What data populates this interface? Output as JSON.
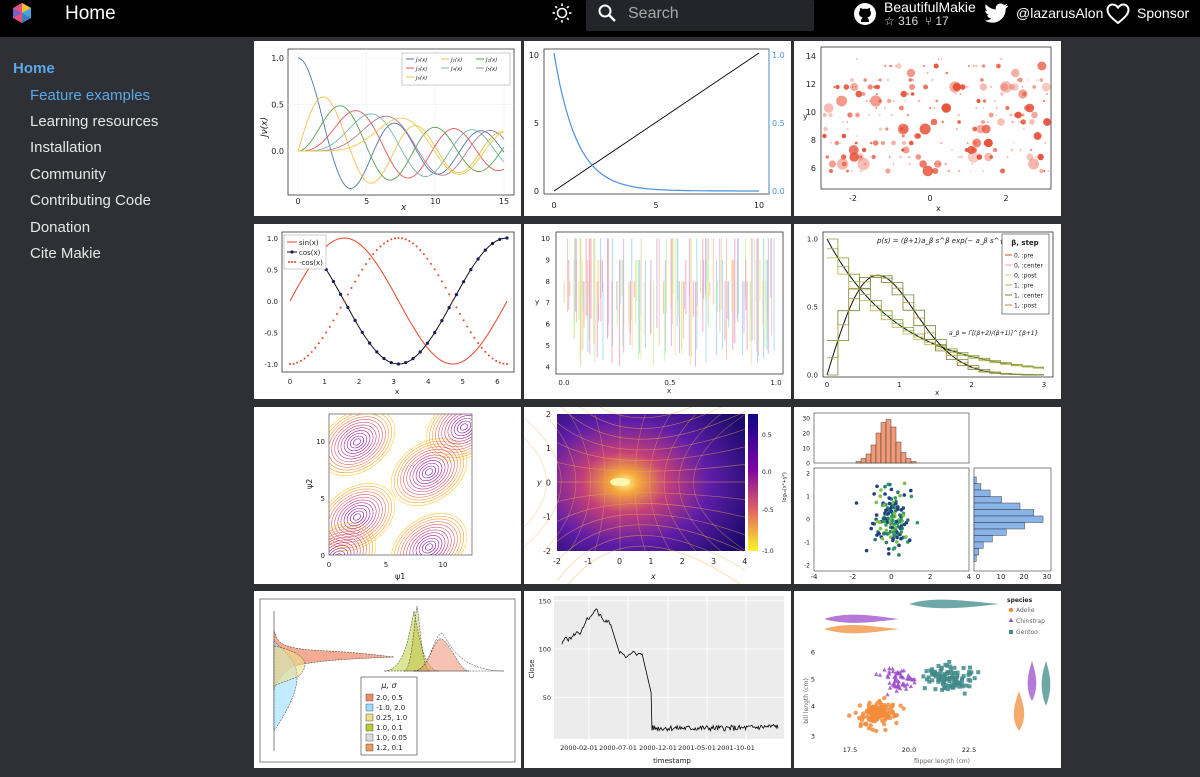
{
  "header": {
    "title": "Home",
    "search_placeholder": "Search",
    "github": {
      "name": "BeautifulMakie",
      "stars": "316",
      "forks": "17"
    },
    "twitter": "@lazarusAlon",
    "sponsor": "Sponsor"
  },
  "sidebar": {
    "home": "Home",
    "items": [
      {
        "label": "Feature examples",
        "active": true
      },
      {
        "label": "Learning resources"
      },
      {
        "label": "Installation"
      },
      {
        "label": "Community"
      },
      {
        "label": "Contributing Code"
      },
      {
        "label": "Donation"
      },
      {
        "label": "Cite Makie"
      }
    ]
  },
  "icons": {
    "logo": "makie-logo-icon",
    "theme": "sun-icon",
    "search": "search-icon",
    "github": "github-icon",
    "twitter": "twitter-icon",
    "sponsor": "heart-icon"
  },
  "colors": {
    "accent": "#5aa9e6",
    "topbar": "#000000",
    "background": "#2e3036"
  },
  "gallery": {
    "bessel": {
      "xticks": [
        "0",
        "5",
        "10",
        "15"
      ],
      "yticks": [
        "0.0",
        "0.5",
        "1.0"
      ],
      "xlabel": "x",
      "ylabel": "Jν(x)",
      "legend": [
        "J₀(x)",
        "J₁(x)",
        "J₂(x)",
        "J₃(x)",
        "J₄(x)",
        "J₅(x)",
        "J₆(x)"
      ]
    },
    "twin_axes": {
      "xticks": [
        "0",
        "5",
        "10"
      ],
      "yticks_left": [
        "0",
        "5",
        "10"
      ],
      "yticks_right": [
        "0.0",
        "0.5",
        "1.0"
      ]
    },
    "bubbles": {
      "xticks": [
        "-2",
        "0",
        "2"
      ],
      "yticks": [
        "6",
        "8",
        "10",
        "12",
        "14"
      ],
      "xlabel": "x",
      "ylabel": "y"
    },
    "trig": {
      "xticks": [
        "0",
        "1",
        "2",
        "3",
        "4",
        "5",
        "6"
      ],
      "yticks": [
        "-1.0",
        "-0.5",
        "0.0",
        "0.5",
        "1.0"
      ],
      "xlabel": "x",
      "legend": [
        "sin(x)",
        "cos(x)",
        "-cos(x)"
      ]
    },
    "rugs": {
      "xticks": [
        "0.0",
        "0.5",
        "1.0"
      ],
      "yticks": [
        "4",
        "5",
        "6",
        "7",
        "8",
        "9",
        "10"
      ],
      "xlabel": "x",
      "ylabel": "y"
    },
    "stairs": {
      "xticks": [
        "0",
        "1",
        "2",
        "3"
      ],
      "yticks": [
        "0.0",
        "0.5",
        "1.0"
      ],
      "xlabel": "x",
      "legend_title": "β, step",
      "legend": [
        "0, :pre",
        "0, :center",
        "0, :post",
        "1, :pre",
        "1, :center",
        "1, :post"
      ],
      "formula_top": "p(s) = (β+1)a_β s^β exp(− a_β s^{β+1})",
      "formula_bottom": "a_β = Γ[(β+2)/(β+1)]^{β+1}"
    },
    "contour": {
      "xticks": [
        "0",
        "5",
        "10"
      ],
      "yticks": [
        "0",
        "5",
        "10"
      ],
      "xlabel": "ψ1",
      "ylabel": "ψ2"
    },
    "streamplot": {
      "xticks": [
        "-2",
        "-1",
        "0",
        "1",
        "2",
        "3",
        "4"
      ],
      "yticks": [
        "-2",
        "-1",
        "0",
        "1",
        "2"
      ],
      "xlabel": "x",
      "ylabel": "y",
      "colorbar_ticks": [
        "0.5",
        "0.0",
        "-0.5",
        "-1.0"
      ],
      "colorbar_label": "log₁₀(x²+y²)"
    },
    "marginal": {
      "top_yticks": [
        "0",
        "10",
        "20",
        "30"
      ],
      "xticks": [
        "-4",
        "-2",
        "0",
        "2",
        "4"
      ],
      "yticks": [
        "-2",
        "-1",
        "0",
        "1",
        "2"
      ],
      "right_xticks": [
        "0",
        "10",
        "20",
        "30"
      ]
    },
    "densities": {
      "legend_title": "μ, σ",
      "legend": [
        "2.0, 0.5",
        "-1.0, 2.0",
        "0.25, 1.0",
        "1.0, 0.1",
        "1.0, 0.05",
        "1.2, 0.1"
      ]
    },
    "timeseries": {
      "xticks": [
        "2000-02-01",
        "2000-07-01",
        "2000-12-01",
        "2001-05-01",
        "2001-10-01"
      ],
      "yticks": [
        "50",
        "100",
        "150"
      ],
      "xlabel": "timestamp",
      "ylabel": "Close"
    },
    "penguins": {
      "xticks": [
        "17.5",
        "20.0",
        "22.5"
      ],
      "yticks": [
        "3",
        "4",
        "5",
        "6"
      ],
      "xlabel": "flipper length (cm)",
      "ylabel": "bill length (cm)",
      "legend_title": "species",
      "legend": [
        "Adelie",
        "Chinstrap",
        "Gentoo"
      ]
    }
  }
}
